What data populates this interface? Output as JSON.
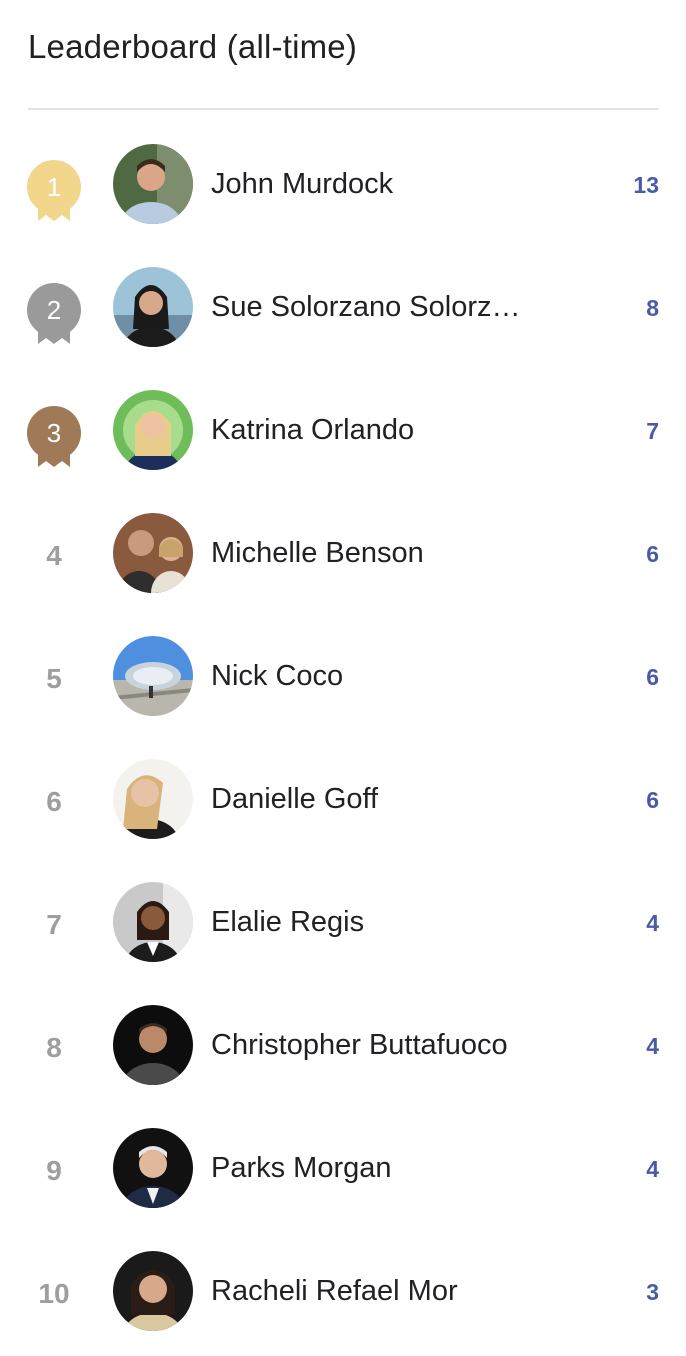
{
  "header": {
    "title": "Leaderboard (all-time)"
  },
  "colors": {
    "gold": "#f2d68c",
    "silver": "#9a9a9a",
    "bronze": "#a07a56",
    "score": "#4a5aa6",
    "rank_plain": "#9e9e9e"
  },
  "leaders": [
    {
      "rank": "1",
      "name": "John Murdock",
      "score": "13",
      "medal": "gold"
    },
    {
      "rank": "2",
      "name": "Sue Solorzano Solorzano",
      "score": "8",
      "medal": "silver"
    },
    {
      "rank": "3",
      "name": "Katrina Orlando",
      "score": "7",
      "medal": "bronze"
    },
    {
      "rank": "4",
      "name": "Michelle Benson",
      "score": "6"
    },
    {
      "rank": "5",
      "name": "Nick Coco",
      "score": "6"
    },
    {
      "rank": "6",
      "name": "Danielle Goff",
      "score": "6"
    },
    {
      "rank": "7",
      "name": "Elalie Regis",
      "score": "4"
    },
    {
      "rank": "8",
      "name": "Christopher Buttafuoco",
      "score": "4"
    },
    {
      "rank": "9",
      "name": "Parks Morgan",
      "score": "4"
    },
    {
      "rank": "10",
      "name": "Racheli Refael Mor",
      "score": "3"
    }
  ]
}
